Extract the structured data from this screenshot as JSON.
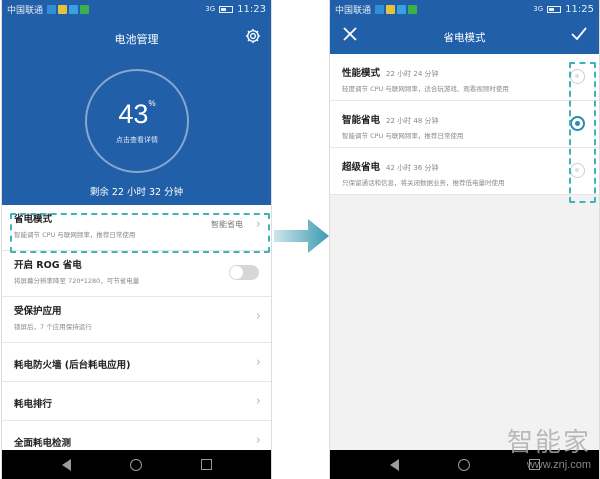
{
  "left": {
    "status": {
      "carrier": "中国联通",
      "signal": "3G",
      "time": "11:23"
    },
    "header": {
      "title": "电池管理"
    },
    "battery": {
      "percent": "43",
      "percent_sign": "%",
      "tap_hint": "点击查看详情",
      "remaining": "剩余 22 小时 32 分钟"
    },
    "items": [
      {
        "title": "省电模式",
        "desc": "智能调节 CPU 与联网频率，推荐日常使用",
        "value": "智能省电"
      },
      {
        "title": "开启 ROG 省电",
        "desc": "将屏幕分辨率降至 720*1280，可节省电量",
        "toggle": false
      },
      {
        "title": "受保护应用",
        "desc": "锁屏后，7 个应用保持运行"
      },
      {
        "title": "耗电防火墙 (后台耗电应用)"
      },
      {
        "title": "耗电排行"
      },
      {
        "title": "全面耗电检测"
      }
    ]
  },
  "right": {
    "status": {
      "carrier": "中国联通",
      "signal": "3G",
      "time": "11:25"
    },
    "header": {
      "title": "省电模式"
    },
    "modes": [
      {
        "name": "性能模式",
        "duration": "22 小时 24 分钟",
        "desc": "轻度调节 CPU 与联网频率，适合玩游戏、观看视频时使用",
        "selected": false
      },
      {
        "name": "智能省电",
        "duration": "22 小时 48 分钟",
        "desc": "智能调节 CPU 与联网频率，推荐日常使用",
        "selected": true
      },
      {
        "name": "超级省电",
        "duration": "42 小时 36 分钟",
        "desc": "只保留通话和信息，将关闭数据业务，推荐低电量时使用",
        "selected": false
      }
    ]
  },
  "watermark": {
    "brand": "智能家",
    "url": "www.znj.com"
  },
  "colors": {
    "header_blue": "#215fa8",
    "accent_teal": "#2a8aa8",
    "arrow_teal": "#3b9ab0",
    "highlight_dash": "#3eb4b8"
  }
}
